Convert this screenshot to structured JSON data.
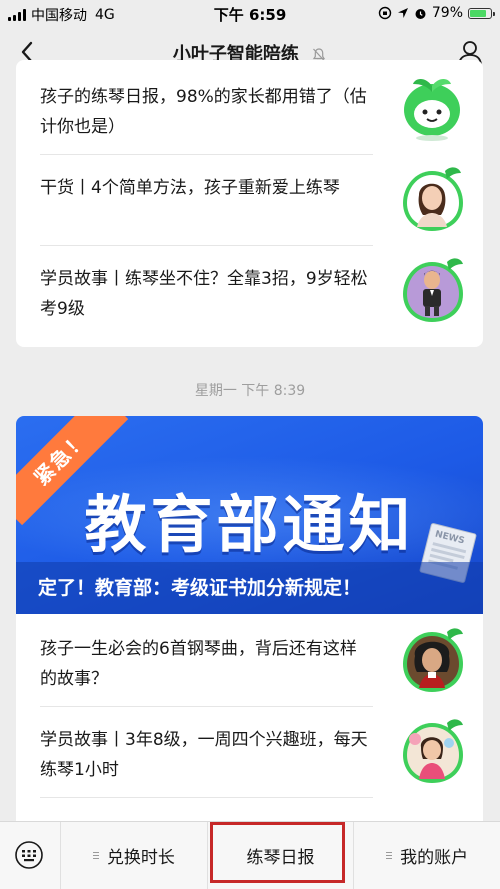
{
  "status_bar": {
    "carrier": "中国移动",
    "network": "4G",
    "time": "下午 6:59",
    "battery": "79%",
    "battery_level": 0.79
  },
  "nav": {
    "title": "小叶子智能陪练",
    "back_icon": "chevron-left-icon",
    "profile_icon": "person-icon",
    "mute_icon": "bell-muted-icon"
  },
  "card1": {
    "articles": [
      {
        "title": "孩子的练琴日报，98%的家长都用错了（估计你也是）",
        "thumb_icon": "leaf-mascot"
      },
      {
        "title": "干货丨4个简单方法，孩子重新爱上练琴",
        "thumb_icon": "woman-portrait"
      },
      {
        "title": "学员故事丨练琴坐不住？全靠3招，9岁轻松考9级",
        "thumb_icon": "child-student"
      }
    ]
  },
  "timestamp": "星期一 下午 8:39",
  "card2": {
    "banner": {
      "ribbon": "紧急！",
      "headline": "教育部通知",
      "subtitle": "定了！教育部：考级证书加分新规定！",
      "newspaper_label": "NEWS"
    },
    "articles": [
      {
        "title": "孩子一生必会的6首钢琴曲，背后还有这样的故事？",
        "thumb_icon": "beethoven-portrait"
      },
      {
        "title": "学员故事丨3年8级，一周四个兴趣班，每天练琴1小时",
        "thumb_icon": "girl-student"
      }
    ]
  },
  "bottom_menu": {
    "keyboard_icon": "keyboard-icon",
    "items": [
      {
        "label": "兑换时长",
        "has_submenu": true
      },
      {
        "label": "练琴日报",
        "has_submenu": false,
        "selected": true
      },
      {
        "label": "我的账户",
        "has_submenu": true
      }
    ]
  },
  "colors": {
    "background": "#ededed",
    "banner_blue": "#1d5ae6",
    "ribbon_orange": "#ff7a3d",
    "mascot_green": "#3ecf5a",
    "highlight_red": "#c62828"
  }
}
